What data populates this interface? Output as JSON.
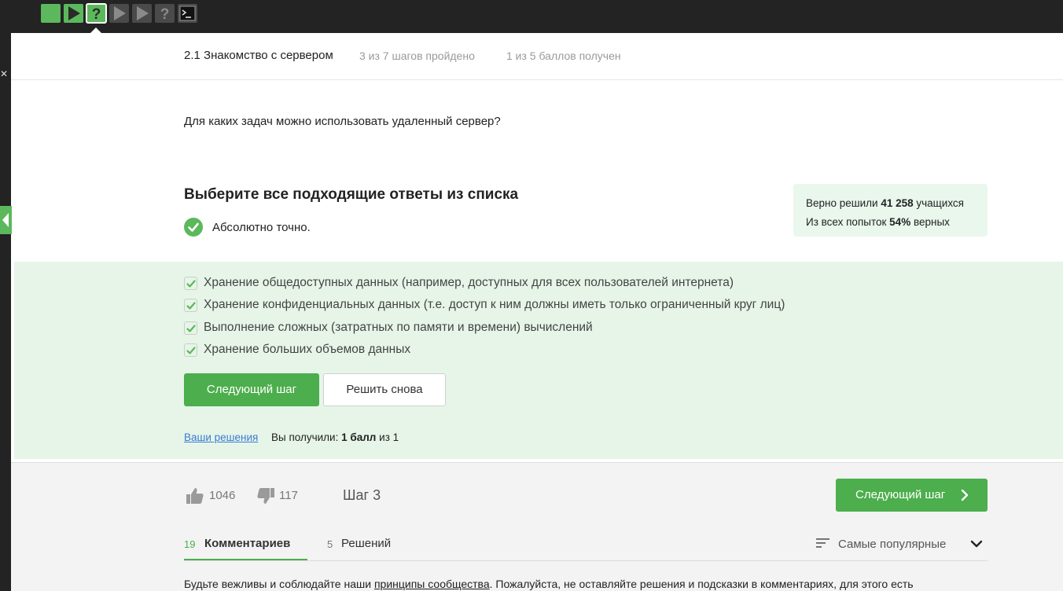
{
  "topbar": {
    "step_icons": [
      "solid-square-icon",
      "play-icon",
      "question-icon",
      "play-icon",
      "play-icon",
      "question-icon",
      "terminal-icon"
    ],
    "accent": "#5cb85c"
  },
  "header": {
    "lesson_title": "2.1 Знакомство с сервером",
    "progress": "3 из 7 шагов пройдено",
    "score": "1 из 5 баллов  получен"
  },
  "question": "Для каких задач можно использовать удаленный сервер?",
  "task": {
    "title": "Выберите все подходящие ответы из списка",
    "feedback": "Абсолютно точно."
  },
  "stats": {
    "line1_prefix": "Верно решили",
    "line1_value": "41 258",
    "line1_suffix": "учащихся",
    "line2_prefix": "Из всех попыток",
    "line2_value": "54%",
    "line2_suffix": "верных"
  },
  "options": [
    {
      "label": "Хранение общедоступных данных (например, доступных для всех пользователей интернета)",
      "checked": true
    },
    {
      "label": "Хранение конфиденциальных данных (т.е. доступ к ним должны иметь только ограниченный круг лиц)",
      "checked": true
    },
    {
      "label": "Выполнение сложных (затратных по памяти и времени) вычислений",
      "checked": true
    },
    {
      "label": "Хранение больших объемов данных",
      "checked": true
    }
  ],
  "actions": {
    "next_label": "Следующий шаг",
    "retry_label": "Решить снова"
  },
  "result": {
    "solutions_link": "Ваши решения",
    "prefix": "Вы получили:",
    "value": "1 балл",
    "suffix": "из 1"
  },
  "footer": {
    "likes": "1046",
    "dislikes": "117",
    "step_label": "Шаг 3",
    "next_label": "Следующий шаг",
    "tabs": [
      {
        "count": "19",
        "label": "Комментариев",
        "active": true
      },
      {
        "count": "5",
        "label": "Решений",
        "active": false
      }
    ],
    "sort_label": "Самые популярные",
    "policy_prefix": "Будьте вежливы и соблюдайте наши",
    "policy_link": "принципы сообщества",
    "policy_suffix": ". Пожалуйста, не оставляйте решения и подсказки в комментариях, для этого есть"
  }
}
